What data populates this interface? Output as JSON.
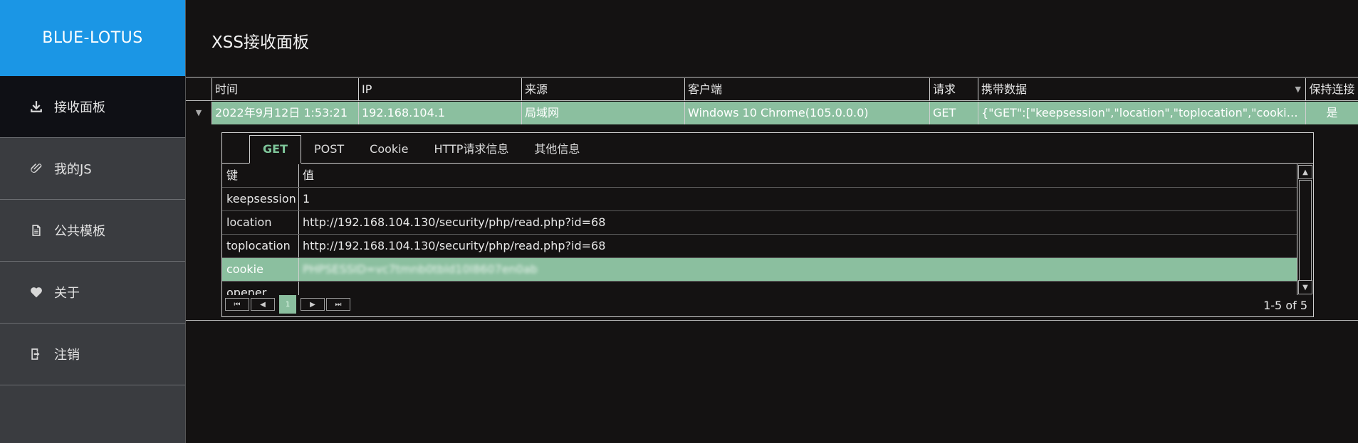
{
  "brand": "BLUE-LOTUS",
  "page_title": "XSS接收面板",
  "nav": [
    {
      "label": "接收面板",
      "icon": "download-icon",
      "active": true
    },
    {
      "label": "我的JS",
      "icon": "paperclip-icon",
      "active": false
    },
    {
      "label": "公共模板",
      "icon": "document-icon",
      "active": false
    },
    {
      "label": "关于",
      "icon": "heart-icon",
      "active": false
    },
    {
      "label": "注销",
      "icon": "logout-icon",
      "active": false
    }
  ],
  "grid": {
    "headers": {
      "time": "时间",
      "ip": "IP",
      "source": "来源",
      "client": "客户端",
      "request": "请求",
      "data": "携带数据",
      "keep": "保持连接"
    },
    "row": {
      "time": "2022年9月12日 1:53:21",
      "ip": "192.168.104.1",
      "source": "局域网",
      "client": "Windows 10 Chrome(105.0.0.0)",
      "request": "GET",
      "data": "{\"GET\":[\"keepsession\",\"location\",\"toplocation\",\"cookie\",\"opener\"]}",
      "keep": "是"
    }
  },
  "detail": {
    "tabs": [
      "GET",
      "POST",
      "Cookie",
      "HTTP请求信息",
      "其他信息"
    ],
    "active_tab": "GET",
    "kv_headers": {
      "key": "键",
      "value": "值"
    },
    "rows": [
      {
        "key": "keepsession",
        "value": "1"
      },
      {
        "key": "location",
        "value": "http://192.168.104.130/security/php/read.php?id=68"
      },
      {
        "key": "toplocation",
        "value": "http://192.168.104.130/security/php/read.php?id=68"
      },
      {
        "key": "cookie",
        "value": "PHPSESSID=vc7tmnb0tbld10l8607en0ab"
      },
      {
        "key": "opener",
        "value": ""
      }
    ],
    "pager": {
      "current_page": "1",
      "info": "1-5 of 5"
    }
  },
  "colors": {
    "brand": "#1b96e5",
    "selected_row": "#8bbf9f",
    "active_tab": "#7fc79b",
    "background": "#141212"
  }
}
